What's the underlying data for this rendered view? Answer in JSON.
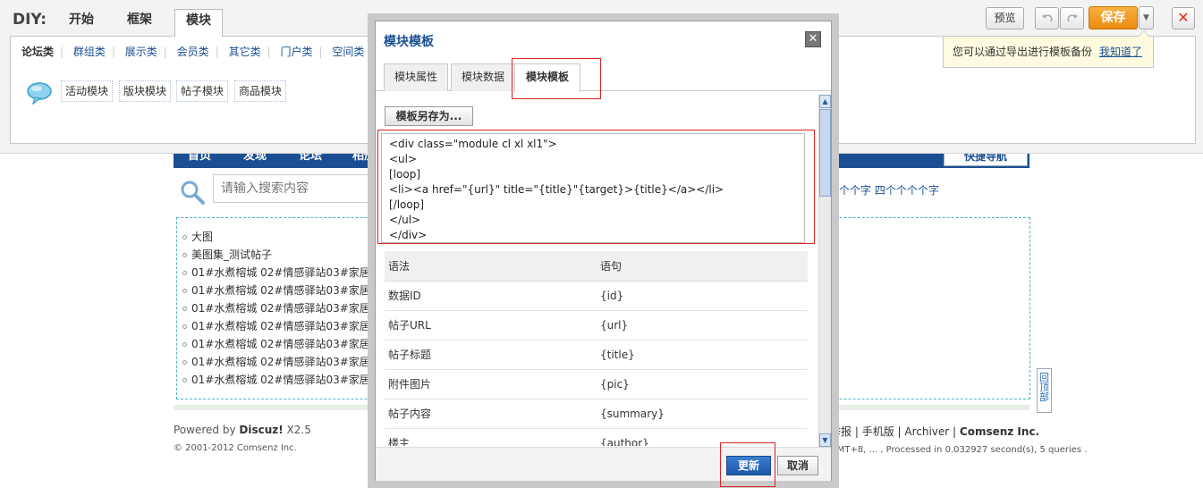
{
  "diy": {
    "label": "DIY:",
    "tabs": [
      "开始",
      "框架",
      "模块"
    ],
    "categories": [
      "论坛类",
      "群组类",
      "展示类",
      "会员类",
      "其它类",
      "门户类",
      "空间类"
    ],
    "modules": [
      "活动模块",
      "版块模块",
      "帖子模块",
      "商品模块"
    ],
    "toolbar": {
      "preview": "预览",
      "undo_icon": "undo-icon",
      "redo_icon": "redo-icon",
      "save": "保存",
      "save_dropdown_icon": "chevron-down-icon",
      "close_icon": "close-icon"
    },
    "hint": {
      "text": "您可以通过导出进行模板备份",
      "link": "我知道了"
    }
  },
  "background": {
    "nav": [
      "首页",
      "发现",
      "论坛",
      "相册"
    ],
    "quick_nav": "快捷导航",
    "search_placeholder": "请输入搜索内容",
    "hot_words": "个个个字   四个个个个字",
    "list": [
      "大图",
      "美图集_测试帖子",
      "01#水煮榕城 02#情感驿站03#家居装",
      "01#水煮榕城 02#情感驿站03#家居装",
      "01#水煮榕城 02#情感驿站03#家居装",
      "01#水煮榕城 02#情感驿站03#家居装",
      "01#水煮榕城 02#情感驿站03#家居装",
      "01#水煮榕城 02#情感驿站03#家居装",
      "01#水煮榕城 02#情感驿站03#家居装"
    ],
    "back_top": "回顶部",
    "footer": {
      "powered_prefix": "Powered by ",
      "powered_brand": "Discuz!",
      "powered_version": " X2.5",
      "copyright": "© 2001-2012 Comsenz Inc.",
      "links": [
        "举报",
        "手机版",
        "Archiver"
      ],
      "company": "Comsenz Inc.",
      "processed": "GMT+8, ... , Processed in 0.032927 second(s), 5 queries ."
    }
  },
  "modal": {
    "title": "模块模板",
    "close_icon": "close-icon",
    "tabs": [
      "模块属性",
      "模块数据",
      "模块模板"
    ],
    "active_tab": 2,
    "save_as": "模板另存为...",
    "code": "<div class=\"module cl xl xl1\">\n<ul>\n[loop]\n<li><a href=\"{url}\" title=\"{title}\"{target}>{title}</a></li>\n[/loop]\n</ul>\n</div>",
    "table": {
      "headers": [
        "语法",
        "语句"
      ],
      "rows": [
        [
          "数据ID",
          "{id}"
        ],
        [
          "帖子URL",
          "{url}"
        ],
        [
          "帖子标题",
          "{title}"
        ],
        [
          "附件图片",
          "{pic}"
        ],
        [
          "帖子内容",
          "{summary}"
        ],
        [
          "楼主",
          "{author}"
        ]
      ]
    },
    "update": "更新",
    "cancel": "取消"
  }
}
